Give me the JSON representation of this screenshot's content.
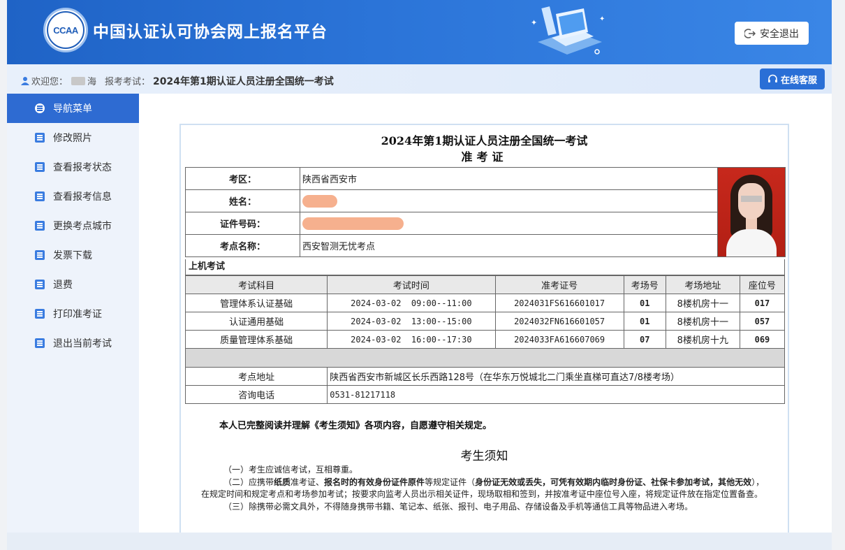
{
  "header": {
    "logo_text": "CCAA",
    "site_title": "中国认证认可协会网上报名平台",
    "logout_label": "安全退出"
  },
  "subbar": {
    "welcome_label": "欢迎您：",
    "welcome_name_visible": "海",
    "exam_label": "报考考试：",
    "exam_name": "2024年第1期认证人员注册全国统一考试",
    "customer_service_label": "在线客服"
  },
  "sidebar": {
    "items": [
      {
        "label": "导航菜单",
        "active": true
      },
      {
        "label": "修改照片"
      },
      {
        "label": "查看报考状态"
      },
      {
        "label": "查看报考信息"
      },
      {
        "label": "更换考点城市"
      },
      {
        "label": "发票下载"
      },
      {
        "label": "退费"
      },
      {
        "label": "打印准考证"
      },
      {
        "label": "退出当前考试"
      }
    ]
  },
  "ticket": {
    "title": "2024年第1期认证人员注册全国统一考试",
    "subtitle": "准考证",
    "info": {
      "region_label": "考区：",
      "region_value": "陕西省西安市",
      "name_label": "姓名：",
      "id_label": "证件号码：",
      "site_label": "考点名称：",
      "site_value": "西安智测无忧考点"
    },
    "section_title": "上机考试",
    "schedule_headers": [
      "考试科目",
      "考试时间",
      "准考证号",
      "考场号",
      "考场地址",
      "座位号"
    ],
    "schedule_rows": [
      {
        "subject": "管理体系认证基础",
        "time": "2024-03-02  09:00--11:00",
        "ticket_no": "2024031FS616601017",
        "room": "01",
        "address": "8楼机房十一",
        "seat": "017"
      },
      {
        "subject": "认证通用基础",
        "time": "2024-03-02  13:00--15:00",
        "ticket_no": "2024032FN616601057",
        "room": "01",
        "address": "8楼机房十一",
        "seat": "057"
      },
      {
        "subject": "质量管理体系基础",
        "time": "2024-03-02  16:00--17:30",
        "ticket_no": "2024033FA616607069",
        "room": "07",
        "address": "8楼机房十九",
        "seat": "069"
      }
    ],
    "address_label": "考点地址",
    "address_value": "陕西省西安市新城区长乐西路128号（在华东万悦城北二门乘坐直梯可直达7/8楼考场）",
    "phone_label": "咨询电话",
    "phone_value": "0531-81217118",
    "declaration": "本人已完整阅读并理解《考生须知》各项内容，自愿遵守相关规定。",
    "notice_title": "考生须知",
    "rules": {
      "r1": "（一）考生应诚信考试，互相尊重。",
      "r2_a": "（二）应携带",
      "r2_b": "纸质",
      "r2_c": "准考证、",
      "r2_d": "报名时的有效身份证件原件",
      "r2_e": "等规定证件（",
      "r2_f": "身份证无效或丢失，可凭有效期内临时身份证、社保卡参加考试，其他无效",
      "r2_g": "），在规定时间和规定考点和考场参加考试；按要求向监考人员出示相关证件，现场取相和签到，并按准考证中座位号入座，将规定证件放在指定位置备查。",
      "r3": "（三）除携带必需文具外，不得随身携带书籍、笔记本、纸张、报刊、电子用品、存储设备及手机等通信工具等物品进入考场。"
    }
  }
}
